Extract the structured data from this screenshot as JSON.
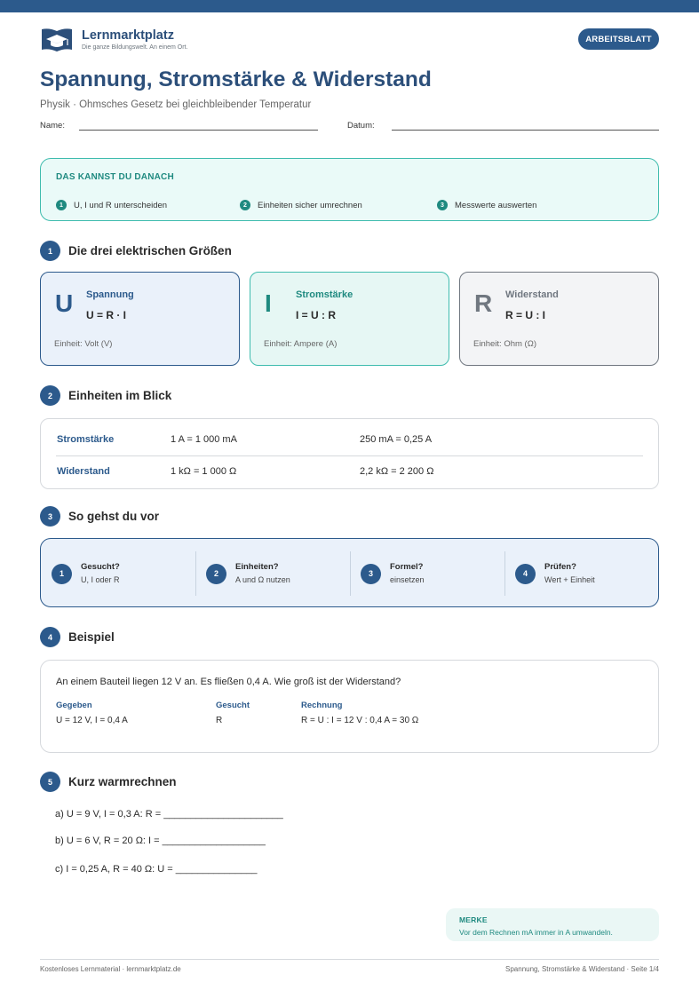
{
  "brand": {
    "name": "Lernmarktplatz",
    "tagline": "Die ganze Bildungswelt. An einem Ort.",
    "badge": "ARBEITSBLATT"
  },
  "header": {
    "title": "Spannung, Stromstärke & Widerstand",
    "subtitle": "Physik · Ohmsches Gesetz bei gleichbleibender Temperatur",
    "name_label": "Name:",
    "date_label": "Datum:"
  },
  "goals": {
    "title": "DAS KANNST DU DANACH",
    "items": [
      {
        "num": "1",
        "text": "U, I und R unterscheiden"
      },
      {
        "num": "2",
        "text": "Einheiten sicher umrechnen"
      },
      {
        "num": "3",
        "text": "Messwerte auswerten"
      }
    ]
  },
  "sections": [
    {
      "num": "1",
      "title": "Die drei elektrischen Größen"
    },
    {
      "num": "2",
      "title": "Einheiten im Blick"
    },
    {
      "num": "3",
      "title": "So gehst du vor"
    },
    {
      "num": "4",
      "title": "Beispiel"
    },
    {
      "num": "5",
      "title": "Kurz warmrechnen"
    }
  ],
  "quantities": [
    {
      "letter": "U",
      "name": "Spannung",
      "formula": "U = R · I",
      "unit": "Einheit: Volt (V)"
    },
    {
      "letter": "I",
      "name": "Stromstärke",
      "formula": "I = U : R",
      "unit": "Einheit: Ampere (A)"
    },
    {
      "letter": "R",
      "name": "Widerstand",
      "formula": "R = U : I",
      "unit": "Einheit: Ohm (Ω)"
    }
  ],
  "units": [
    {
      "label": "Stromstärke",
      "a": "1 A = 1 000 mA",
      "b": "250 mA = 0,25 A"
    },
    {
      "label": "Widerstand",
      "a": "1 kΩ = 1 000 Ω",
      "b": "2,2 kΩ = 2 200 Ω"
    }
  ],
  "steps": [
    {
      "num": "1",
      "title": "Gesucht?",
      "sub": "U, I oder R"
    },
    {
      "num": "2",
      "title": "Einheiten?",
      "sub": "A und Ω nutzen"
    },
    {
      "num": "3",
      "title": "Formel?",
      "sub": "einsetzen"
    },
    {
      "num": "4",
      "title": "Prüfen?",
      "sub": "Wert + Einheit"
    }
  ],
  "example": {
    "question": "An einem Bauteil liegen 12 V an. Es fließen 0,4 A. Wie groß ist der Widerstand?",
    "given_label": "Gegeben",
    "given": "U = 12 V, I = 0,4 A",
    "wanted_label": "Gesucht",
    "wanted": "R",
    "calc_label": "Rechnung",
    "calc": "R = U : I = 12 V : 0,4 A = 30 Ω"
  },
  "tasks": [
    "a) U = 9 V, I = 0,3 A: R = ______________________",
    "b) U = 6 V, R = 20 Ω: I = ___________________",
    "c) I = 0,25 A, R = 40 Ω: U = _______________"
  ],
  "merke": {
    "title": "MERKE",
    "text": "Vor dem Rechnen mA immer in A umwandeln."
  },
  "footer": {
    "left": "Kostenloses Lernmaterial · lernmarktplatz.de",
    "right": "Spannung, Stromstärke & Widerstand · Seite 1/4"
  }
}
